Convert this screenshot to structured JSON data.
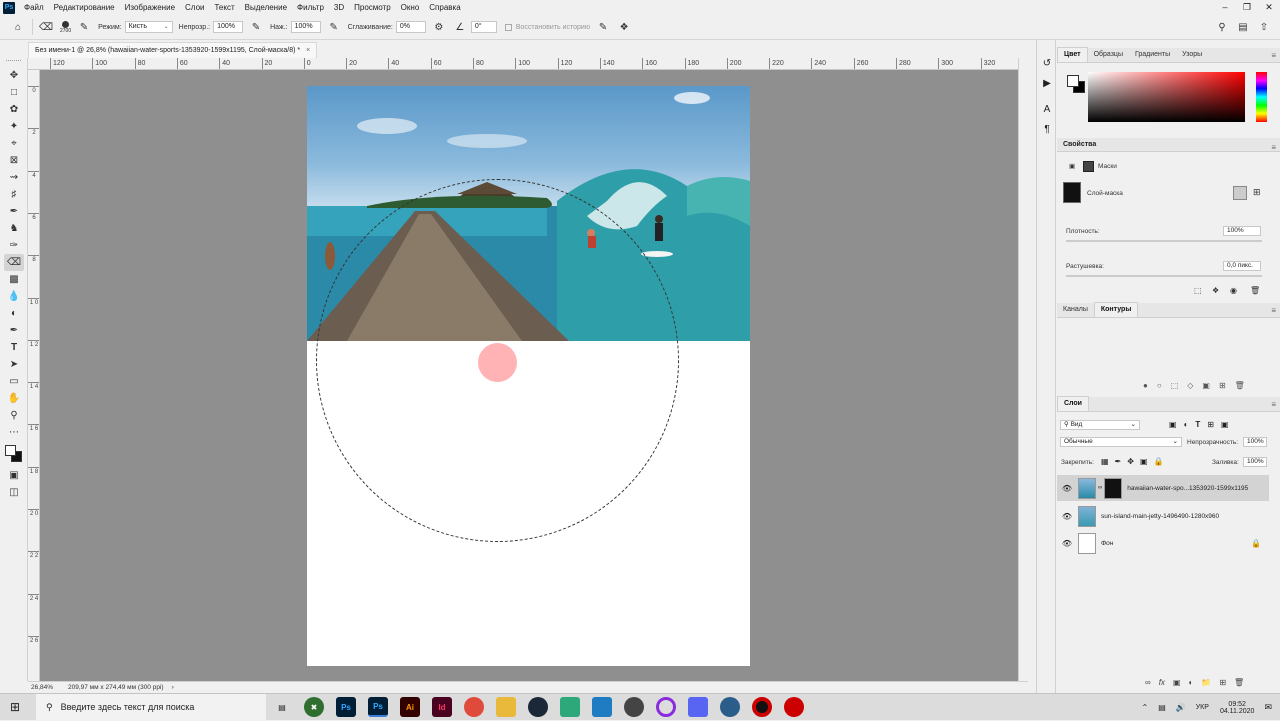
{
  "menubar": {
    "app_icon": "Ps",
    "items": [
      "Файл",
      "Редактирование",
      "Изображение",
      "Слои",
      "Текст",
      "Выделение",
      "Фильтр",
      "3D",
      "Просмотр",
      "Окно",
      "Справка"
    ],
    "window_controls": [
      "minimize-icon",
      "restore-icon",
      "close-icon"
    ]
  },
  "options_bar": {
    "brush_size": "2700",
    "mode_label": "Режим:",
    "mode_value": "Кисть",
    "opacity_label": "Непрозр.:",
    "opacity_value": "100%",
    "flow_label": "Наж.:",
    "flow_value": "100%",
    "smoothing_label": "Сглаживание:",
    "smoothing_value": "0%",
    "angle_value": "0°",
    "history_label": "Восстановить историю"
  },
  "document": {
    "tab_title": "Без имени-1 @ 26,8% (hawaiian-water-sports-1353920-1599x1195, Слой-маска/8) *",
    "close_label": "×",
    "zoom": "26,84%",
    "doc_size": "209,97 мм x 274,49 мм (300 ppi)"
  },
  "rulers": {
    "top": [
      "120",
      "100",
      "80",
      "60",
      "40",
      "20",
      "0",
      "20",
      "40",
      "60",
      "80",
      "100",
      "120",
      "140",
      "160",
      "180",
      "200",
      "220",
      "240",
      "260",
      "280",
      "300",
      "320"
    ],
    "left": [
      "0",
      "2",
      "4",
      "6",
      "8",
      "1 0",
      "1 2",
      "1 4",
      "1 6",
      "1 8",
      "2 0",
      "2 2",
      "2 4",
      "2 6"
    ]
  },
  "color_panel": {
    "tabs": [
      "Цвет",
      "Образцы",
      "Градиенты",
      "Узоры"
    ],
    "active_tab": "Цвет",
    "foreground": "#ffffff",
    "background": "#000000"
  },
  "properties_panel": {
    "title": "Свойства",
    "masks_label": "Маски",
    "layer_mask_label": "Слой-маска",
    "density_label": "Плотность:",
    "density_value": "100%",
    "feather_label": "Растушевка:",
    "feather_value": "0,0 пикс."
  },
  "paths_panel": {
    "tabs": [
      "Каналы",
      "Контуры"
    ],
    "active_tab": "Контуры"
  },
  "layers_panel": {
    "title": "Слои",
    "filter_label": "Вид",
    "blend_mode": "Обычные",
    "opacity_label": "Непрозрачность:",
    "opacity_value": "100%",
    "lock_label": "Закрепить:",
    "fill_label": "Заливка:",
    "fill_value": "100%",
    "layers": [
      {
        "name": "hawaiian-water-spo...1353920-1599x1195",
        "selected": true
      },
      {
        "name": "sun-island-main-jetty-1496490-1280x960",
        "selected": false
      },
      {
        "name": "Фон",
        "selected": false
      }
    ]
  },
  "taskbar": {
    "search_placeholder": "Введите здесь текст для поиска",
    "apps": [
      "Ps",
      "Ps",
      "Ai",
      "Id"
    ],
    "language": "УКР",
    "time": "09:52",
    "date": "04.11.2020"
  }
}
